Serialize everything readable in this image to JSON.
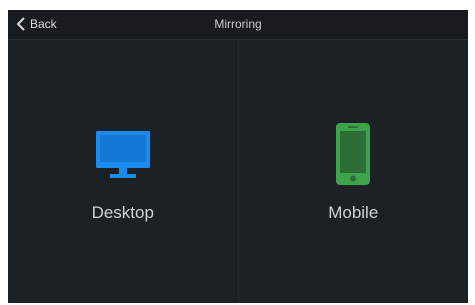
{
  "header": {
    "back_label": "Back",
    "title": "Mirroring"
  },
  "options": [
    {
      "label": "Desktop",
      "icon": "desktop-monitor-icon",
      "color": "#1a8cf0"
    },
    {
      "label": "Mobile",
      "icon": "mobile-phone-icon",
      "color": "#3ea34a"
    }
  ],
  "colors": {
    "background": "#1c2126",
    "top_bar": "#181c21",
    "text": "#cfd3d7"
  }
}
